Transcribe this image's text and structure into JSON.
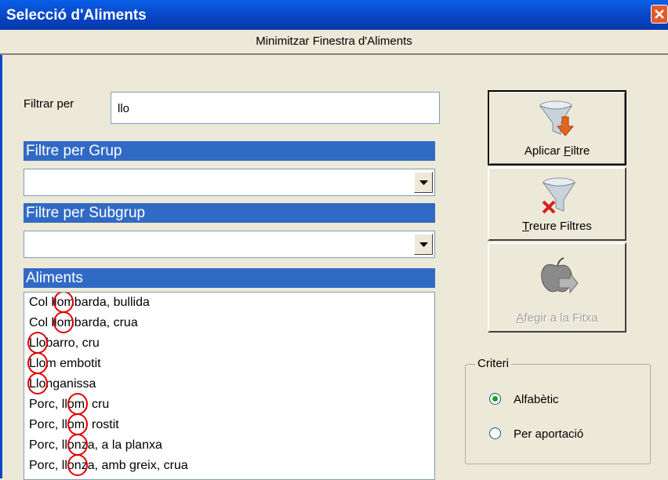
{
  "window": {
    "title": "Selecció d'Aliments"
  },
  "minimize_bar": {
    "label": "Minimitzar Finestra d'Aliments"
  },
  "filter": {
    "label": "Filtrar per",
    "value": "llo"
  },
  "group_filter": {
    "header": "Filtre per Grup",
    "selected": ""
  },
  "subgroup_filter": {
    "header": "Filtre per Subgrup",
    "selected": ""
  },
  "foods": {
    "header": "Aliments",
    "items": [
      "Col llombarda, bullida",
      "Col llombarda, crua",
      "Llobarro, cru",
      "Llom embotit",
      "Llonganissa",
      "Porc, llom, cru",
      "Porc, llom, rostit",
      "Porc, llonza, a la planxa",
      "Porc, llonza, amb greix, crua"
    ]
  },
  "buttons": {
    "apply": {
      "pre": "Aplicar ",
      "u": "F",
      "post": "iltre",
      "icon": "funnel-down-arrow-icon"
    },
    "clear": {
      "pre": "",
      "u": "T",
      "post": "reure Filtres",
      "icon": "funnel-x-icon"
    },
    "add": {
      "pre": "",
      "u": "A",
      "post": "fegir a la Fitxa",
      "icon": "apple-arrow-icon",
      "enabled": false
    }
  },
  "criteria": {
    "legend": "Criteri",
    "options": [
      {
        "label": "Alfabètic",
        "checked": true
      },
      {
        "label": "Per aportació",
        "checked": false
      }
    ]
  },
  "colors": {
    "title_bar": "#0848c8",
    "section_header": "#316ac5",
    "highlight_circle": "#e00000",
    "window_bg": "#ece9d8"
  }
}
